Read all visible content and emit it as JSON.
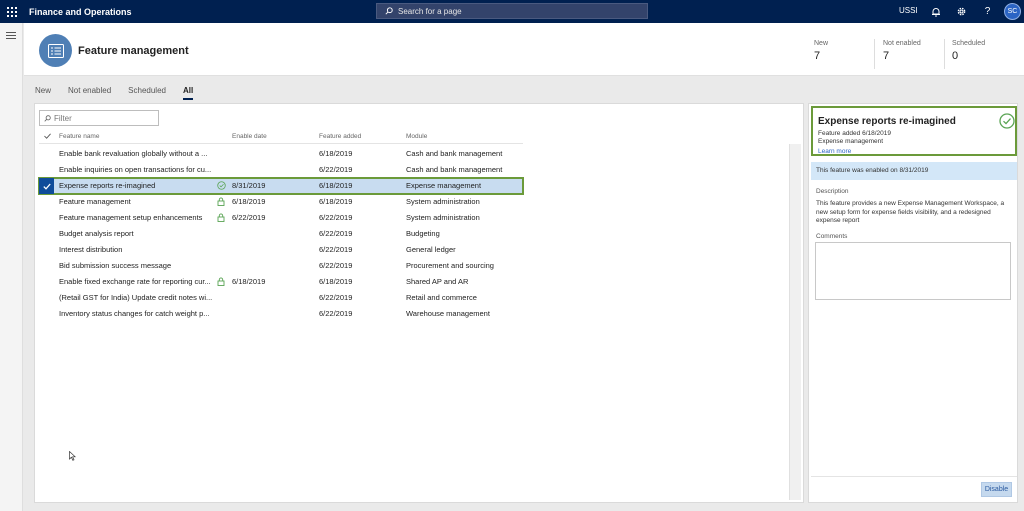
{
  "app": {
    "title": "Finance and Operations",
    "search_placeholder": "Search for a page",
    "company": "USSI",
    "user_initials": "SC"
  },
  "header": {
    "title": "Feature management",
    "stats": [
      {
        "label": "New",
        "value": "7"
      },
      {
        "label": "Not enabled",
        "value": "7"
      },
      {
        "label": "Scheduled",
        "value": "0"
      }
    ]
  },
  "tabs": [
    {
      "label": "New",
      "active": false
    },
    {
      "label": "Not enabled",
      "active": false
    },
    {
      "label": "Scheduled",
      "active": false
    },
    {
      "label": "All",
      "active": true
    }
  ],
  "filter": {
    "placeholder": "Filter"
  },
  "grid": {
    "columns": [
      "Feature name",
      "Enable date",
      "Feature added",
      "Module"
    ],
    "rows": [
      {
        "name": "Enable bank revaluation globally without a ...",
        "status_icon": "",
        "enable_date": "",
        "added": "6/18/2019",
        "module": "Cash and bank management"
      },
      {
        "name": "Enable inquiries on open transactions for cu...",
        "status_icon": "",
        "enable_date": "",
        "added": "6/22/2019",
        "module": "Cash and bank management"
      },
      {
        "name": "Expense reports re-imagined",
        "status_icon": "check-circle-icon",
        "enable_date": "8/31/2019",
        "added": "6/18/2019",
        "module": "Expense management",
        "selected": true
      },
      {
        "name": "Feature management",
        "status_icon": "lock-icon",
        "enable_date": "6/18/2019",
        "added": "6/18/2019",
        "module": "System administration"
      },
      {
        "name": "Feature management setup enhancements",
        "status_icon": "lock-icon",
        "enable_date": "6/22/2019",
        "added": "6/22/2019",
        "module": "System administration"
      },
      {
        "name": "Budget analysis report",
        "status_icon": "",
        "enable_date": "",
        "added": "6/22/2019",
        "module": "Budgeting"
      },
      {
        "name": "Interest distribution",
        "status_icon": "",
        "enable_date": "",
        "added": "6/22/2019",
        "module": "General ledger"
      },
      {
        "name": "Bid submission success message",
        "status_icon": "",
        "enable_date": "",
        "added": "6/22/2019",
        "module": "Procurement and sourcing"
      },
      {
        "name": "Enable fixed exchange rate for reporting cur...",
        "status_icon": "lock-icon",
        "enable_date": "6/18/2019",
        "added": "6/18/2019",
        "module": "Shared AP and AR"
      },
      {
        "name": "(Retail GST for India) Update credit notes wi...",
        "status_icon": "",
        "enable_date": "",
        "added": "6/22/2019",
        "module": "Retail and commerce"
      },
      {
        "name": "Inventory status changes for catch weight p...",
        "status_icon": "",
        "enable_date": "",
        "added": "6/22/2019",
        "module": "Warehouse management"
      }
    ]
  },
  "details": {
    "title": "Expense reports re-imagined",
    "feature_added": "Feature added 6/18/2019",
    "module": "Expense management",
    "learn_more": "Learn more",
    "enabled_message": "This feature was enabled on 8/31/2019",
    "description_label": "Description",
    "description": "This feature provides a new Expense Management Workspace, a new setup form for expense fields visibility, and a redesigned expense report",
    "comments_label": "Comments",
    "disable_label": "Disable"
  },
  "colors": {
    "navbar": "#002050",
    "accent": "#2b64c4",
    "highlight_border": "#6b9a3a",
    "selected_row": "#c8dcf0",
    "status_green": "#5aa454"
  }
}
